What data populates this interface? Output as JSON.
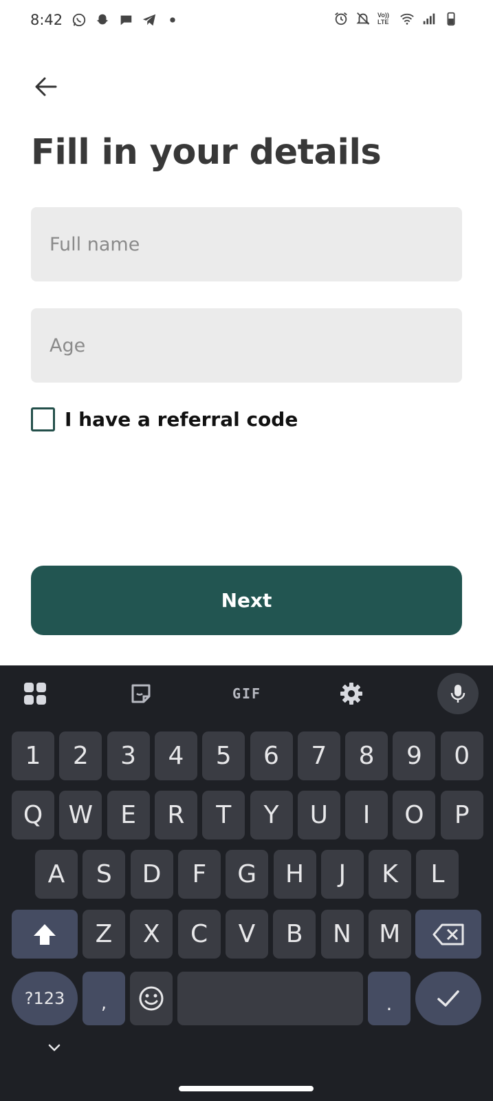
{
  "status_bar": {
    "time": "8:42",
    "left_icons": [
      "whatsapp-icon",
      "snapchat-icon",
      "chat-bubble-icon",
      "telegram-icon",
      "dot-icon"
    ],
    "right_icons": [
      "alarm-icon",
      "mute-icon",
      "volte-icon",
      "wifi-icon",
      "signal-icon",
      "battery-icon"
    ],
    "volte_text": "Vo)) LTE"
  },
  "header": {
    "back_icon": "arrow-left-icon",
    "title": "Fill in your details"
  },
  "form": {
    "full_name": {
      "value": "",
      "placeholder": "Full name"
    },
    "age": {
      "value": "",
      "placeholder": "Age"
    },
    "referral_checkbox": {
      "label": "I have a referral code",
      "checked": false
    },
    "next_label": "Next"
  },
  "colors": {
    "primary": "#225551",
    "field_bg": "#ebebeb",
    "keyboard_bg": "#1e2025",
    "key_bg": "#3a3c43",
    "key_action_bg": "#454c62"
  },
  "keyboard": {
    "toolbar": {
      "apps_icon": "grid-icon",
      "sticker_icon": "sticker-icon",
      "gif_label": "GIF",
      "settings_icon": "gear-icon",
      "mic_icon": "microphone-icon"
    },
    "row_numbers": [
      "1",
      "2",
      "3",
      "4",
      "5",
      "6",
      "7",
      "8",
      "9",
      "0"
    ],
    "row_1": [
      "Q",
      "W",
      "E",
      "R",
      "T",
      "Y",
      "U",
      "I",
      "O",
      "P"
    ],
    "row_2": [
      "A",
      "S",
      "D",
      "F",
      "G",
      "H",
      "J",
      "K",
      "L"
    ],
    "row_3": [
      "Z",
      "X",
      "C",
      "V",
      "B",
      "N",
      "M"
    ],
    "shift_icon": "shift-arrow-icon",
    "backspace_icon": "backspace-icon",
    "symbols_label": "?123",
    "comma_label": ",",
    "emoji_icon": "emoji-icon",
    "period_label": ".",
    "enter_icon": "checkmark-icon",
    "collapse_icon": "chevron-down-icon"
  }
}
